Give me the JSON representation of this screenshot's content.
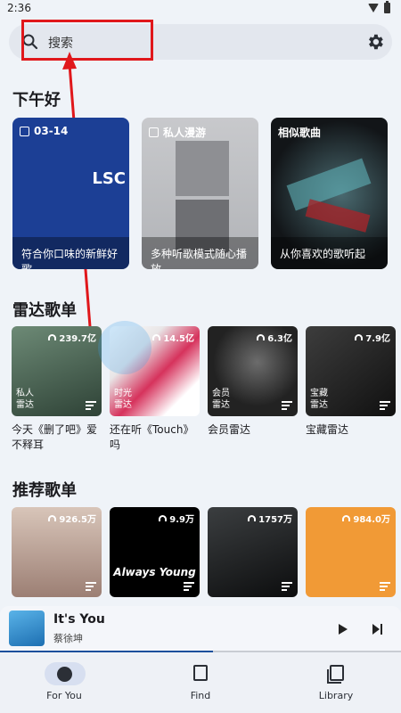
{
  "status_bar": {
    "time": "2:36"
  },
  "search": {
    "placeholder": "搜索"
  },
  "daily": {
    "section_title": "下午好",
    "cards": [
      {
        "tag": "03-14",
        "caption": "符合你口味的新鲜好歌",
        "art_text": "LSC"
      },
      {
        "tag": "私人漫游",
        "caption": "多种听歌模式随心播放"
      },
      {
        "tag": "相似歌曲",
        "caption": "从你喜欢的歌听起"
      }
    ]
  },
  "radar": {
    "section_title": "雷达歌单",
    "items": [
      {
        "count": "239.7亿",
        "sub": "私人\n雷达",
        "title": "今天《删了吧》爱不释耳"
      },
      {
        "count": "14.5亿",
        "sub": "时光\n雷达",
        "title": "还在听《Touch》吗"
      },
      {
        "count": "6.3亿",
        "sub": "会员\n雷达",
        "title": "会员雷达"
      },
      {
        "count": "7.9亿",
        "sub": "宝藏\n雷达",
        "title": "宝藏雷达"
      }
    ]
  },
  "recommended": {
    "section_title": "推荐歌单",
    "items": [
      {
        "count": "926.5万"
      },
      {
        "count": "9.9万",
        "art_text": "Always Young"
      },
      {
        "count": "1757万"
      },
      {
        "count": "984.0万"
      }
    ]
  },
  "player": {
    "title": "It's You",
    "artist": "蔡徐坤",
    "progress": 0.53
  },
  "nav": [
    {
      "label": "For You",
      "active": true
    },
    {
      "label": "Find"
    },
    {
      "label": "Library"
    }
  ],
  "colors": {
    "accent": "#1b4f9c",
    "highlight": "#e0171b",
    "background": "#eff3f8"
  }
}
